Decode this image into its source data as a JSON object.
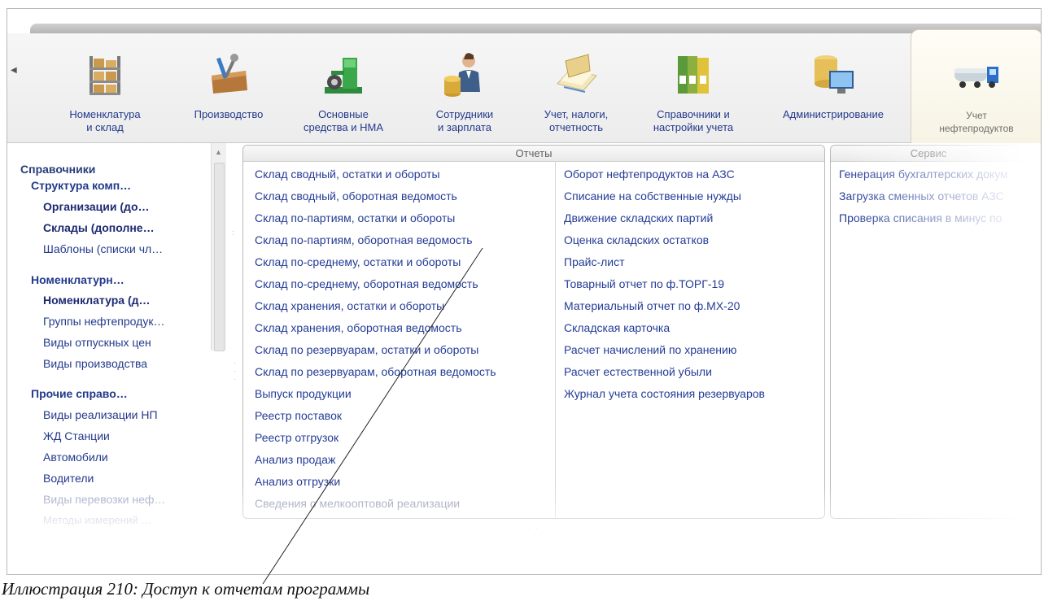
{
  "toolbar": {
    "sections": [
      {
        "label": "Номенклатура\nи склад",
        "icon": "warehouse-shelves-icon"
      },
      {
        "label": "Производство",
        "icon": "toolbox-icon"
      },
      {
        "label": "Основные\nсредства и НМА",
        "icon": "machine-icon"
      },
      {
        "label": "Сотрудники\nи зарплата",
        "icon": "employee-coins-icon"
      },
      {
        "label": "Учет, налоги,\nотчетность",
        "icon": "calculator-documents-icon"
      },
      {
        "label": "Справочники и\nнастройки учета",
        "icon": "folders-icon"
      },
      {
        "label": "Администрирование",
        "icon": "database-monitor-icon"
      },
      {
        "label": "Учет\nнефтепродуктов",
        "icon": "tanker-truck-icon"
      }
    ]
  },
  "sidebar": {
    "title": "Справочники",
    "items": [
      {
        "text": "Структура комп…",
        "style": "heading"
      },
      {
        "text": "Организации (до…",
        "style": "bold"
      },
      {
        "text": "Склады (дополне…",
        "style": "bold"
      },
      {
        "text": "Шаблоны (списки чл…",
        "style": "normal"
      },
      {
        "text": "Номенклатурн…",
        "style": "heading"
      },
      {
        "text": "Номенклатура (д…",
        "style": "bold"
      },
      {
        "text": "Группы нефтепродук…",
        "style": "normal"
      },
      {
        "text": "Виды отпускных цен",
        "style": "normal"
      },
      {
        "text": "Виды производства",
        "style": "normal"
      },
      {
        "text": "Прочие справо…",
        "style": "heading"
      },
      {
        "text": "Виды реализации НП",
        "style": "normal"
      },
      {
        "text": "ЖД Станции",
        "style": "normal"
      },
      {
        "text": "Автомобили",
        "style": "normal"
      },
      {
        "text": "Водители",
        "style": "normal"
      },
      {
        "text": "Виды перевозки неф…",
        "style": "gray"
      },
      {
        "text": "Методы измерений …",
        "style": "gray2"
      }
    ]
  },
  "reports": {
    "title": "Отчеты",
    "col1": [
      "Склад сводный, остатки и обороты",
      "Склад сводный, оборотная ведомость",
      "Склад по-партиям, остатки и обороты",
      "Склад по-партиям, оборотная ведомость",
      "Склад по-среднему, остатки и обороты",
      "Склад по-среднему, оборотная ведомость",
      "Склад хранения, остатки и обороты",
      "Склад хранения, оборотная ведомость",
      "Склад по резервуарам, остатки и обороты",
      "Склад по резервуарам, оборотная ведомость",
      "Выпуск продукции",
      "Реестр поставок",
      "Реестр отгрузок",
      "Анализ продаж",
      "Анализ отгрузки",
      "Сведения о мелкооптовой реализации"
    ],
    "col2": [
      "Оборот нефтепродуктов на АЗС",
      "Списание на собственные нужды",
      "Движение складских партий",
      "Оценка складских остатков",
      "Прайс-лист",
      "Товарный отчет по ф.ТОРГ-19",
      "Материальный отчет по ф.МХ-20",
      "Складская карточка",
      "Расчет начислений по хранению",
      "Расчет естественной убыли",
      "Журнал учета состояния резервуаров"
    ]
  },
  "service": {
    "title": "Сервис",
    "items": [
      "Генерация бухгалтерских докум",
      "Загрузка сменных отчетов АЗС",
      "Проверка списания в минус по"
    ]
  },
  "caption": "Иллюстрация 210: Доступ к отчетам программы"
}
